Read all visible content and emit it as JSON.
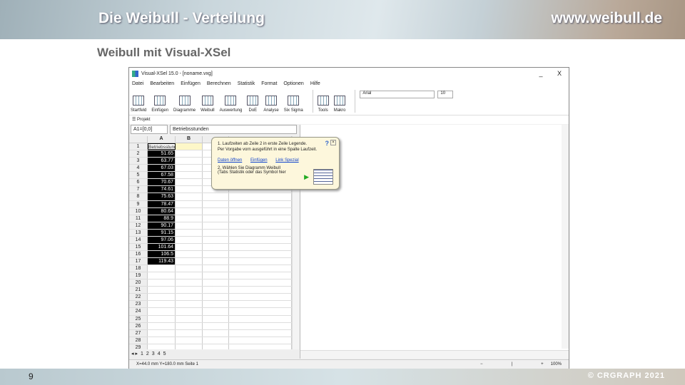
{
  "slide": {
    "title": "Die Weibull - Verteilung",
    "url": "www.weibull.de",
    "subtitle": "Weibull mit Visual-XSel",
    "page": "9",
    "copyright": "© CRGRAPH 2021"
  },
  "window": {
    "title": "Visual-XSel 15.0 - [noname.vxg]",
    "minimize": "_",
    "close": "X"
  },
  "menu": [
    "Datei",
    "Bearbeiten",
    "Einfügen",
    "Berechnen",
    "Statistik",
    "Format",
    "Optionen",
    "Hilfe"
  ],
  "toolbar": [
    "Startfeld",
    "Einfügen",
    "Diagramme",
    "Weibull",
    "Auswertung",
    "DoE",
    "Analyse",
    "Six Sigma",
    "Tools",
    "Makro"
  ],
  "font": {
    "name": "Arial",
    "size": "10"
  },
  "project_label": "Projekt",
  "formula": {
    "cell": "A1=[0,0]",
    "value": "Betriebsstunden"
  },
  "columns": [
    "",
    "A",
    "B",
    "",
    ""
  ],
  "header_cell": "Betriebsstunden",
  "values": [
    "51.65",
    "63.77",
    "67.03",
    "67.58",
    "70.67",
    "74.61",
    "75.63",
    "78.47",
    "80.64",
    "88.9",
    "90.17",
    "91.15",
    "97.06",
    "101.64",
    "106.5",
    "119.43"
  ],
  "row_count": 29,
  "sheet_tabs": [
    "1",
    "2",
    "3",
    "4",
    "5"
  ],
  "status": {
    "pos": "X=44.0 mm  Y=180.0 mm  Seite 1",
    "zoom": "100%"
  },
  "tip": {
    "step1": "1. Laufzeiten ab Zeile 2 in erste Zeile Legende.",
    "step1b": "Per Vorgabe vorn ausgeführt in eine Spalte Laufzeit.",
    "links": [
      "Daten öffnen",
      "Einfügen",
      "Link Spezial"
    ],
    "step2": "2. Wählen Sie Diagramm Weibull",
    "step2b": "(Tabs Statistik oder das Symbol hier"
  }
}
